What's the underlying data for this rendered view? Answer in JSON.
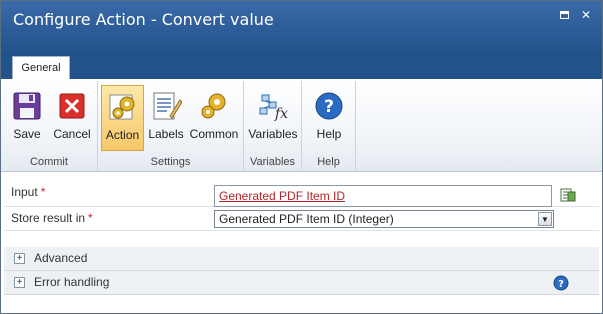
{
  "window": {
    "title": "Configure Action - Convert value",
    "minimize_glyph": "—",
    "close_glyph": "✕"
  },
  "tabs": [
    {
      "label": "General",
      "active": true
    }
  ],
  "ribbon": {
    "groups": [
      {
        "label": "Commit",
        "buttons": [
          {
            "label": "Save",
            "icon": "save-icon"
          },
          {
            "label": "Cancel",
            "icon": "cancel-icon"
          }
        ]
      },
      {
        "label": "Settings",
        "buttons": [
          {
            "label": "Action",
            "icon": "action-gears-icon",
            "active": true
          },
          {
            "label": "Labels",
            "icon": "labels-icon"
          },
          {
            "label": "Common",
            "icon": "common-gears-icon"
          }
        ]
      },
      {
        "label": "Variables",
        "buttons": [
          {
            "label": "Variables",
            "icon": "variables-fx-icon"
          }
        ]
      },
      {
        "label": "Help",
        "buttons": [
          {
            "label": "Help",
            "icon": "help-icon"
          }
        ]
      }
    ]
  },
  "form": {
    "input_label": "Input",
    "input_value": "Generated PDF Item ID",
    "store_label": "Store result in",
    "store_value": "Generated PDF Item ID (Integer)",
    "required_mark": "*",
    "select_arrow": "▼"
  },
  "sections": [
    {
      "label": "Advanced",
      "toggle": "+"
    },
    {
      "label": "Error handling",
      "toggle": "+"
    }
  ],
  "colors": {
    "titlebar": "#2d5a93",
    "required": "#c0282d",
    "link": "#b22525",
    "active_button": "#f8c86a"
  }
}
